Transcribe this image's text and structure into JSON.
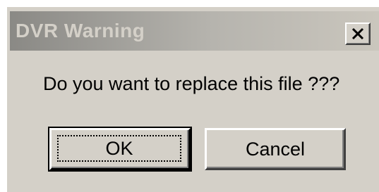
{
  "dialog": {
    "title": "DVR Warning",
    "message": "Do you want to replace this file ???",
    "buttons": {
      "ok": "OK",
      "cancel": "Cancel"
    },
    "close_icon": "close-icon"
  },
  "colors": {
    "face": "#d4d0c8",
    "titlebar_start": "#8a8985",
    "titlebar_end": "#cac6bd",
    "title_text": "#d4d0c8"
  }
}
